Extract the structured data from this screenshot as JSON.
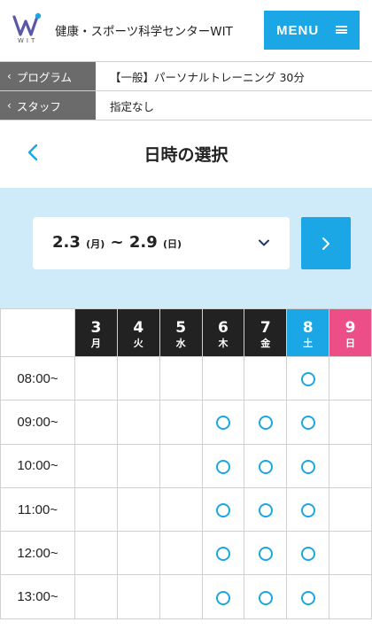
{
  "header": {
    "logo_text": "WIT",
    "site_title": "健康・スポーツ科学センターWIT",
    "menu_label": "MENU"
  },
  "breadcrumbs": [
    {
      "label": "プログラム",
      "value": "【一般】パーソナルトレーニング 30分"
    },
    {
      "label": "スタッフ",
      "value": "指定なし"
    }
  ],
  "page_title": "日時の選択",
  "week": {
    "start_date": "2.3",
    "start_weekday": "(月)",
    "separator": " ~ ",
    "end_date": "2.9",
    "end_weekday": "(日)"
  },
  "colors": {
    "accent": "#1ba6e6",
    "saturday": "#1ba6e6",
    "sunday": "#ec4f87",
    "weekday_header": "#222222",
    "week_bg": "#cfeaf8"
  },
  "days": [
    {
      "num": "3",
      "wd": "月",
      "type": "weekday"
    },
    {
      "num": "4",
      "wd": "火",
      "type": "weekday"
    },
    {
      "num": "5",
      "wd": "水",
      "type": "weekday"
    },
    {
      "num": "6",
      "wd": "木",
      "type": "weekday"
    },
    {
      "num": "7",
      "wd": "金",
      "type": "weekday"
    },
    {
      "num": "8",
      "wd": "土",
      "type": "sat"
    },
    {
      "num": "9",
      "wd": "日",
      "type": "sun"
    }
  ],
  "slots": [
    {
      "time": "08:00~",
      "available": [
        false,
        false,
        false,
        false,
        false,
        true,
        false
      ]
    },
    {
      "time": "09:00~",
      "available": [
        false,
        false,
        false,
        true,
        true,
        true,
        false
      ]
    },
    {
      "time": "10:00~",
      "available": [
        false,
        false,
        false,
        true,
        true,
        true,
        false
      ]
    },
    {
      "time": "11:00~",
      "available": [
        false,
        false,
        false,
        true,
        true,
        true,
        false
      ]
    },
    {
      "time": "12:00~",
      "available": [
        false,
        false,
        false,
        true,
        true,
        true,
        false
      ]
    },
    {
      "time": "13:00~",
      "available": [
        false,
        false,
        false,
        true,
        true,
        true,
        false
      ]
    }
  ],
  "icons": {
    "back": "chevron-left-icon",
    "caret": "chevron-down-icon",
    "next": "chevron-right-icon",
    "menu": "hamburger-icon",
    "slot": "circle-available-icon"
  }
}
